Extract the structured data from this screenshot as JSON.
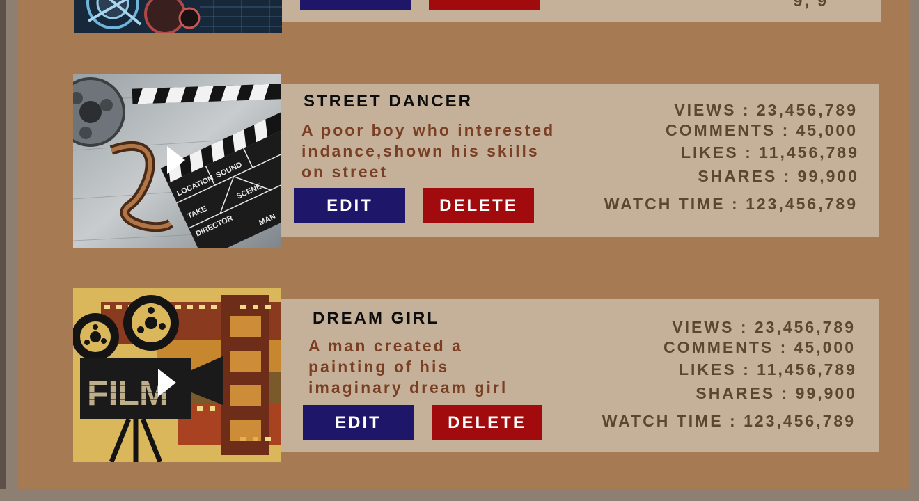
{
  "colors": {
    "panel": "#a67a52",
    "card": "#c5b19a",
    "edit_button": "#1e1669",
    "delete_button": "#a10b0d",
    "description": "#7a3e22",
    "stats": "#5b4630"
  },
  "prev_card": {
    "stats_partial": "9, 9"
  },
  "videos": [
    {
      "title": "STREET DANCER",
      "description": [
        "A poor boy who interested",
        "indance,shown his skills",
        "on street"
      ],
      "edit_label": "EDIT",
      "delete_label": "DELETE",
      "stats": {
        "views": "VIEWS : 23,456,789",
        "comments": "COMMENTS : 45,000",
        "likes": "LIKES : 11,456,789",
        "shares": "SHARES : 99,900",
        "watch_time": "WATCH TIME : 123,456,789"
      },
      "thumbnail_icon": "clapperboard-film-reel-icon"
    },
    {
      "title": "DREAM GIRL",
      "description": [
        "A man created a",
        "painting of his",
        "imaginary dream girl"
      ],
      "edit_label": "EDIT",
      "delete_label": "DELETE",
      "stats": {
        "views": "VIEWS : 23,456,789",
        "comments": "COMMENTS : 45,000",
        "likes": "LIKES : 11,456,789",
        "shares": "SHARES : 99,900",
        "watch_time": "WATCH TIME : 123,456,789"
      },
      "thumbnail_icon": "film-camera-icon",
      "thumbnail_text": "FILM"
    }
  ]
}
